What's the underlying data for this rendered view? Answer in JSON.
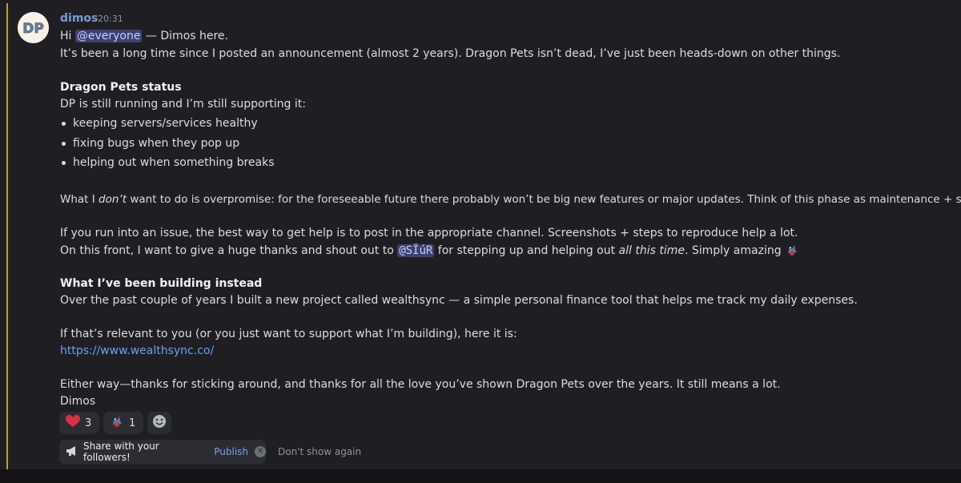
{
  "message": {
    "author": "dimos",
    "time": "20:31",
    "avatar_text": "DP",
    "line1": {
      "before": "Hi ",
      "mention": "@everyone",
      "after": " — Dimos here."
    },
    "line2": "It’s been a long time since I posted an announcement (almost 2 years). Dragon Pets isn’t dead, I’ve just been heads-down on other things.",
    "status_heading": "Dragon Pets status",
    "status_intro": "DP is still running and I’m still supporting it:",
    "bullets": [
      "keeping servers/services healthy",
      "fixing bugs when they pop up",
      "helping out when something breaks"
    ],
    "line_overpromise": {
      "before": "What I ",
      "em": "don’t",
      "after": " want to do is overpromise: for the foreseeable future there probably won’t be big new features or major updates. Think of this phase as maintenance + stability."
    },
    "line_issue": "If you run into an issue, the best way to get help is to post in the appropriate channel. Screenshots + steps to reproduce help a lot.",
    "line_thanks": {
      "before": "On this front, I want to give a huge thanks and shout out to ",
      "mention": "@SÏúR",
      "middle": " for stepping up and helping out ",
      "em": "all this time",
      "after": ". Simply amazing "
    },
    "building_heading": "What I’ve been building instead",
    "line_building": "Over the past couple of years I built a new project called wealthsync — a simple personal finance tool that helps me track my daily expenses.",
    "line_relevant": "If that’s relevant to you (or you just want to support what I’m building), here it is:",
    "link": "https://www.wealthsync.co/",
    "line_either": "Either way—thanks for sticking around, and thanks for all the love you’ve shown Dragon Pets over the years. It still means a lot.",
    "signoff": "Dimos"
  },
  "reactions": [
    {
      "emoji": "heart-emoji",
      "count": "3"
    },
    {
      "emoji": "dragon-emoji",
      "count": "1"
    }
  ],
  "share_prompt": {
    "icon": "megaphone-icon",
    "text": "Share with your followers!",
    "publish": "Publish",
    "dismiss": "Don't show again"
  },
  "colors": {
    "background": "#1f1f23",
    "author": "#7a9bd6",
    "mention_bg": "#3c4270",
    "link": "#6e9ef0",
    "highlight_bar": "#c29b3c"
  }
}
